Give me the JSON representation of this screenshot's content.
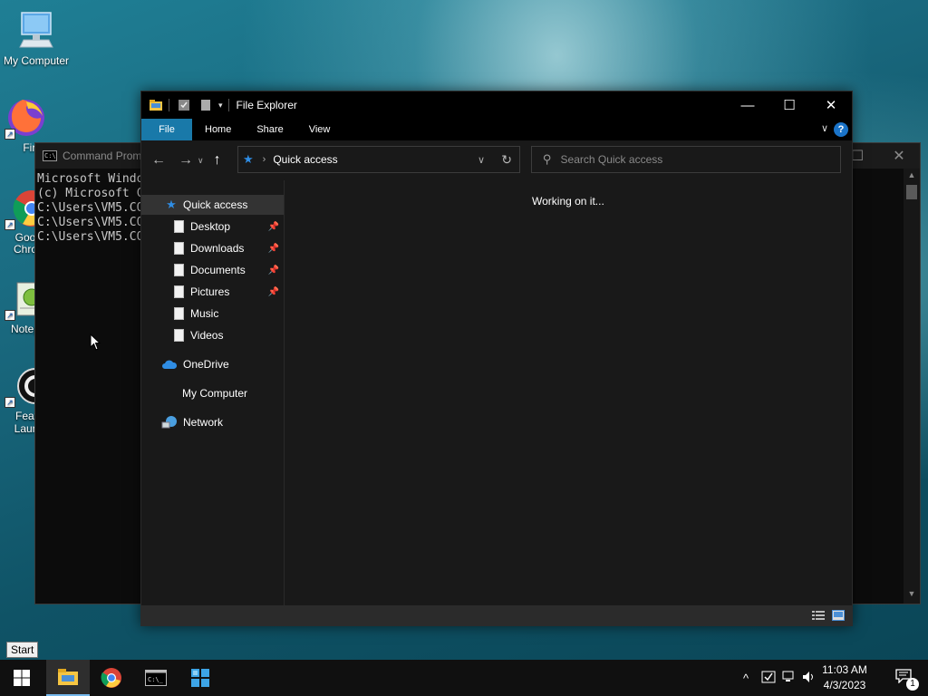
{
  "desktop": {
    "icons": [
      {
        "label": "My Computer"
      },
      {
        "label": "Fire"
      },
      {
        "label": "Goo Chro"
      },
      {
        "label": "Notep"
      },
      {
        "label": "Feat Laun"
      }
    ]
  },
  "cmd": {
    "title": "Command Prom",
    "lines": [
      "Microsoft Windo",
      "(c) Microsoft C",
      "",
      "C:\\Users\\VM5.CO",
      "",
      "C:\\Users\\VM5.CO",
      "",
      "C:\\Users\\VM5.CO"
    ]
  },
  "explorer": {
    "title": "File Explorer",
    "ribbon_tabs": [
      "File",
      "Home",
      "Share",
      "View"
    ],
    "help_label": "?",
    "address_text": "Quick access",
    "search_placeholder": "Search Quick access",
    "status_message": "Working on it...",
    "nav": {
      "quick_access": "Quick access",
      "pinned": [
        "Desktop",
        "Downloads",
        "Documents",
        "Pictures"
      ],
      "unpinned": [
        "Music",
        "Videos"
      ],
      "onedrive": "OneDrive",
      "my_computer": "My Computer",
      "network": "Network"
    }
  },
  "taskbar": {
    "start_tooltip": "Start",
    "time": "11:03 AM",
    "date": "4/3/2023",
    "notification_count": "1"
  },
  "colors": {
    "accent": "#1979a9",
    "quick_access_star": "#2f8de4",
    "taskbar_active": "#76b9ed"
  }
}
